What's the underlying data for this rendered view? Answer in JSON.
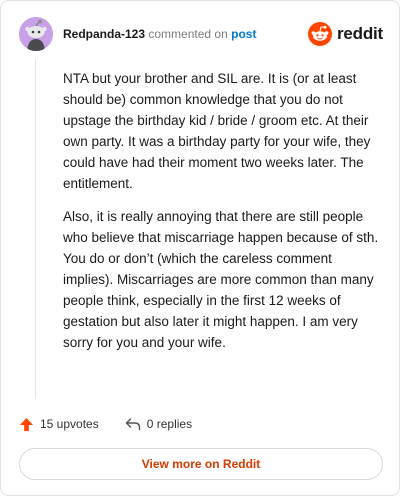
{
  "header": {
    "author": "Redpanda-123",
    "commented_text": "commented on",
    "post_link": "post",
    "brand": "reddit"
  },
  "comment": {
    "paragraphs": [
      "NTA but your brother and SIL are. It is (or at least should be) common knowledge that you do not upstage the birthday kid / bride / groom etc. At their own party. It was a birthday party for your wife, they could have had their moment two weeks later. The entitlement.",
      "Also, it is really annoying that there are still people who believe that miscarriage happen because of sth. You do or don’t (which the careless comment implies). Miscarriages are more common than many people think, especially in the first 12 weeks of gestation but also later it might happen. I am very sorry for you and your wife."
    ]
  },
  "actions": {
    "upvotes": "15 upvotes",
    "replies": "0 replies"
  },
  "view_more": "View more on Reddit",
  "icons": {
    "avatar": "snoo-avatar-icon",
    "brand": "reddit-logo-icon",
    "upvote": "upvote-arrow-icon",
    "reply": "reply-arrow-icon"
  },
  "colors": {
    "brand_orange": "#ff4500",
    "link_blue": "#0079d3",
    "view_more_text": "#d93a00",
    "avatar_bg": "#c7a0e6"
  }
}
